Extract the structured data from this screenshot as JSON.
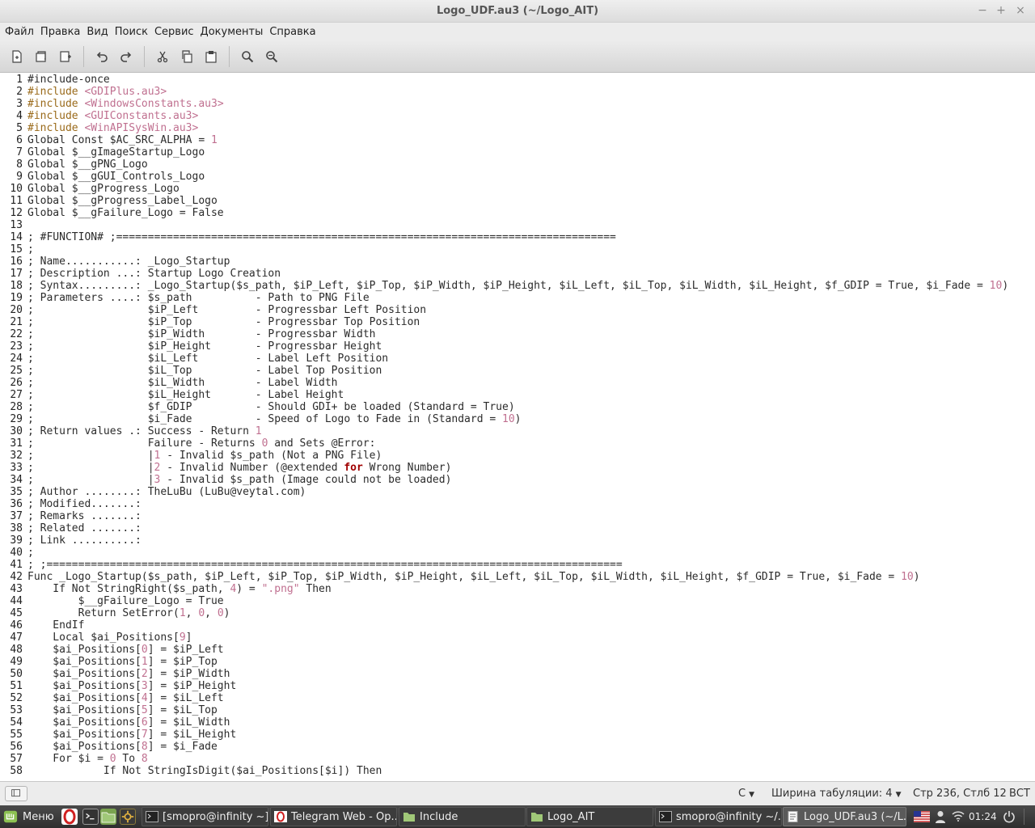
{
  "window": {
    "title": "Logo_UDF.au3 (~/Logo_AIT)",
    "minimize": "−",
    "maximize": "+",
    "close": "×"
  },
  "menu": [
    "Файл",
    "Правка",
    "Вид",
    "Поиск",
    "Сервис",
    "Документы",
    "Справка"
  ],
  "toolbar": [
    "new-document-icon",
    "open-file-icon",
    "save-file-icon",
    "undo-icon",
    "redo-icon",
    "cut-icon",
    "copy-icon",
    "paste-icon",
    "find-icon",
    "find-replace-icon"
  ],
  "editor": {
    "lines": [
      {
        "n": "1",
        "t": "#include-once"
      },
      {
        "n": "2",
        "t": "#include <GDIPlus.au3>"
      },
      {
        "n": "3",
        "t": "#include <WindowsConstants.au3>"
      },
      {
        "n": "4",
        "t": "#include <GUIConstants.au3>"
      },
      {
        "n": "5",
        "t": "#include <WinAPISysWin.au3>"
      },
      {
        "n": "6",
        "t": "Global Const $AC_SRC_ALPHA = 1"
      },
      {
        "n": "7",
        "t": "Global $__gImageStartup_Logo"
      },
      {
        "n": "8",
        "t": "Global $__gPNG_Logo"
      },
      {
        "n": "9",
        "t": "Global $__gGUI_Controls_Logo"
      },
      {
        "n": "10",
        "t": "Global $__gProgress_Logo"
      },
      {
        "n": "11",
        "t": "Global $__gProgress_Label_Logo"
      },
      {
        "n": "12",
        "t": "Global $__gFailure_Logo = False"
      },
      {
        "n": "13",
        "t": ""
      },
      {
        "n": "14",
        "t": "; #FUNCTION# ;==============================================================================="
      },
      {
        "n": "15",
        "t": ";"
      },
      {
        "n": "16",
        "t": "; Name...........: _Logo_Startup"
      },
      {
        "n": "17",
        "t": "; Description ...: Startup Logo Creation"
      },
      {
        "n": "18",
        "t": "; Syntax.........: _Logo_Startup($s_path, $iP_Left, $iP_Top, $iP_Width, $iP_Height, $iL_Left, $iL_Top, $iL_Width, $iL_Height, $f_GDIP = True, $i_Fade = 10)"
      },
      {
        "n": "19",
        "t": "; Parameters ....: $s_path          - Path to PNG File"
      },
      {
        "n": "20",
        "t": ";                  $iP_Left         - Progressbar Left Position"
      },
      {
        "n": "21",
        "t": ";                  $iP_Top          - Progressbar Top Position"
      },
      {
        "n": "22",
        "t": ";                  $iP_Width        - Progressbar Width"
      },
      {
        "n": "23",
        "t": ";                  $iP_Height       - Progressbar Height"
      },
      {
        "n": "24",
        "t": ";                  $iL_Left         - Label Left Position"
      },
      {
        "n": "25",
        "t": ";                  $iL_Top          - Label Top Position"
      },
      {
        "n": "26",
        "t": ";                  $iL_Width        - Label Width"
      },
      {
        "n": "27",
        "t": ";                  $iL_Height       - Label Height"
      },
      {
        "n": "28",
        "t": ";                  $f_GDIP          - Should GDI+ be loaded (Standard = True)"
      },
      {
        "n": "29",
        "t": ";                  $i_Fade          - Speed of Logo to Fade in (Standard = 10)"
      },
      {
        "n": "30",
        "t": "; Return values .: Success - Return 1"
      },
      {
        "n": "31",
        "t": ";                  Failure - Returns 0 and Sets @Error:"
      },
      {
        "n": "32",
        "t": ";                  |1 - Invalid $s_path (Not a PNG File)"
      },
      {
        "n": "33",
        "t": ";                  |2 - Invalid Number (@extended for Wrong Number)"
      },
      {
        "n": "34",
        "t": ";                  |3 - Invalid $s_path (Image could not be loaded)"
      },
      {
        "n": "35",
        "t": "; Author ........: TheLuBu (LuBu@veytal.com)"
      },
      {
        "n": "36",
        "t": "; Modified.......:"
      },
      {
        "n": "37",
        "t": "; Remarks .......:"
      },
      {
        "n": "38",
        "t": "; Related .......:"
      },
      {
        "n": "39",
        "t": "; Link ..........:"
      },
      {
        "n": "40",
        "t": ";"
      },
      {
        "n": "41",
        "t": "; ;==========================================================================================="
      },
      {
        "n": "42",
        "t": "Func _Logo_Startup($s_path, $iP_Left, $iP_Top, $iP_Width, $iP_Height, $iL_Left, $iL_Top, $iL_Width, $iL_Height, $f_GDIP = True, $i_Fade = 10)"
      },
      {
        "n": "43",
        "t": "    If Not StringRight($s_path, 4) = \".png\" Then"
      },
      {
        "n": "44",
        "t": "        $__gFailure_Logo = True"
      },
      {
        "n": "45",
        "t": "        Return SetError(1, 0, 0)"
      },
      {
        "n": "46",
        "t": "    EndIf"
      },
      {
        "n": "47",
        "t": "    Local $ai_Positions[9]"
      },
      {
        "n": "48",
        "t": "    $ai_Positions[0] = $iP_Left"
      },
      {
        "n": "49",
        "t": "    $ai_Positions[1] = $iP_Top"
      },
      {
        "n": "50",
        "t": "    $ai_Positions[2] = $iP_Width"
      },
      {
        "n": "51",
        "t": "    $ai_Positions[3] = $iP_Height"
      },
      {
        "n": "52",
        "t": "    $ai_Positions[4] = $iL_Left"
      },
      {
        "n": "53",
        "t": "    $ai_Positions[5] = $iL_Top"
      },
      {
        "n": "54",
        "t": "    $ai_Positions[6] = $iL_Width"
      },
      {
        "n": "55",
        "t": "    $ai_Positions[7] = $iL_Height"
      },
      {
        "n": "56",
        "t": "    $ai_Positions[8] = $i_Fade"
      },
      {
        "n": "57",
        "t": "    For $i = 0 To 8"
      },
      {
        "n": "58",
        "t": "            If Not StringIsDigit($ai_Positions[$i]) Then"
      }
    ]
  },
  "status": {
    "language": "C",
    "tab_width": "Ширина табуляции:  4",
    "cursor": "Стр 236, Стлб 12",
    "mode": "ВСТ"
  },
  "taskbar": {
    "menu_label": "Меню",
    "tasks": [
      {
        "label": "[smopro@infinity ~]",
        "icon": "terminal-icon"
      },
      {
        "label": "Telegram Web - Op...",
        "icon": "opera-icon"
      },
      {
        "label": "Include",
        "icon": "folder-icon"
      },
      {
        "label": "Logo_AIT",
        "icon": "folder-icon"
      },
      {
        "label": "smopro@infinity ~/...",
        "icon": "terminal-icon"
      },
      {
        "label": "Logo_UDF.au3 (~/L...",
        "icon": "text-editor-icon"
      }
    ],
    "time": "01:24"
  },
  "colors": {
    "keyword": "#9a6a1a",
    "string": "#c07090",
    "bold_keyword": "#a00000"
  }
}
